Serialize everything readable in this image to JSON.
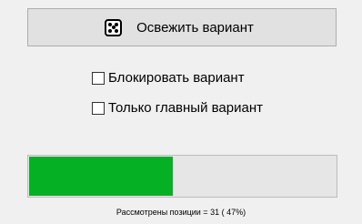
{
  "refresh_button": {
    "label": "Освежить вариант",
    "icon": "dice-icon"
  },
  "options": [
    {
      "label": "Блокировать вариант",
      "checked": false
    },
    {
      "label": "Только главный вариант",
      "checked": false
    }
  ],
  "progress": {
    "fraction": 0.47,
    "fill_color": "#06b025"
  },
  "status": {
    "text": "Рассмотрены позиции = 31 ( 47%)"
  }
}
